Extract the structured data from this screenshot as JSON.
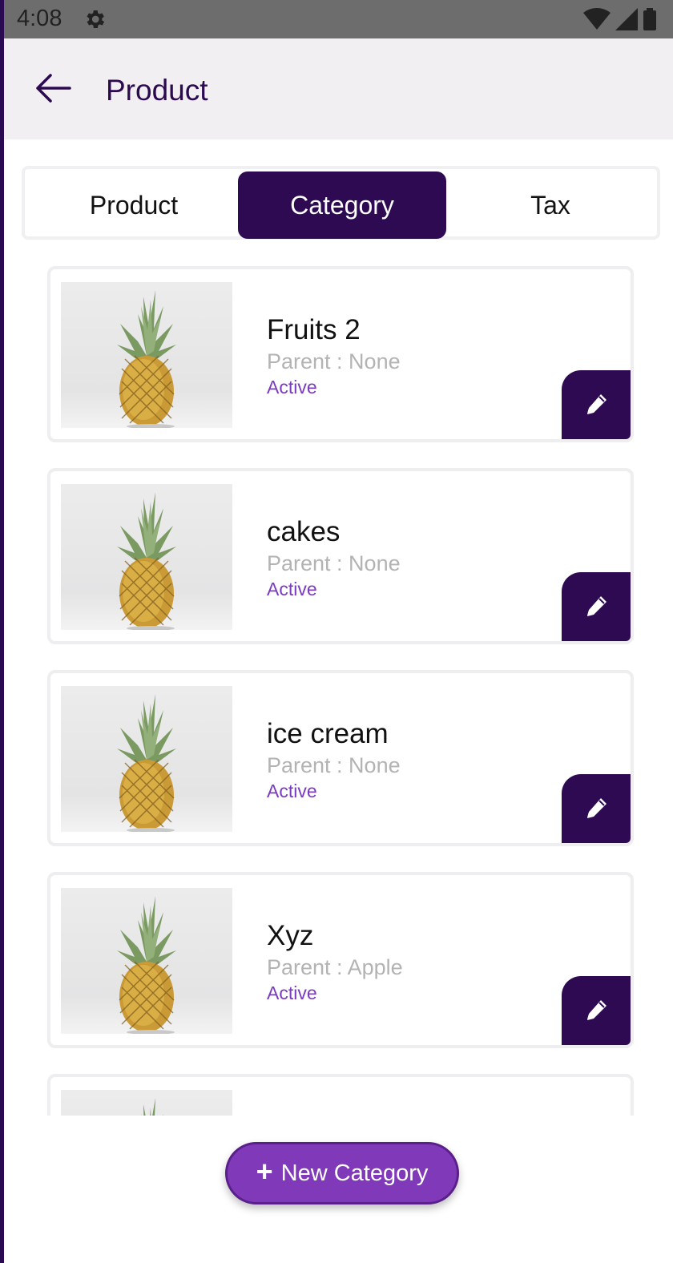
{
  "status_bar": {
    "time": "4:08"
  },
  "app_bar": {
    "title": "Product"
  },
  "tabs": [
    {
      "label": "Product",
      "selected": false
    },
    {
      "label": "Category",
      "selected": true
    },
    {
      "label": "Tax",
      "selected": false
    }
  ],
  "categories": [
    {
      "name": "Fruits 2",
      "parent": "Parent : None",
      "status": "Active"
    },
    {
      "name": "cakes",
      "parent": "Parent : None",
      "status": "Active"
    },
    {
      "name": "ice cream",
      "parent": "Parent : None",
      "status": "Active"
    },
    {
      "name": "Xyz",
      "parent": "Parent : Apple",
      "status": "Active"
    },
    {
      "name": "",
      "parent": "",
      "status": ""
    }
  ],
  "fab": {
    "label": "New Category"
  },
  "colors": {
    "primary": "#2d0a51",
    "accent": "#8039b8",
    "active_text": "#7b3bc0"
  },
  "icons": {
    "back": "arrow-left-icon",
    "edit": "pencil-icon",
    "settings": "gear-icon"
  }
}
